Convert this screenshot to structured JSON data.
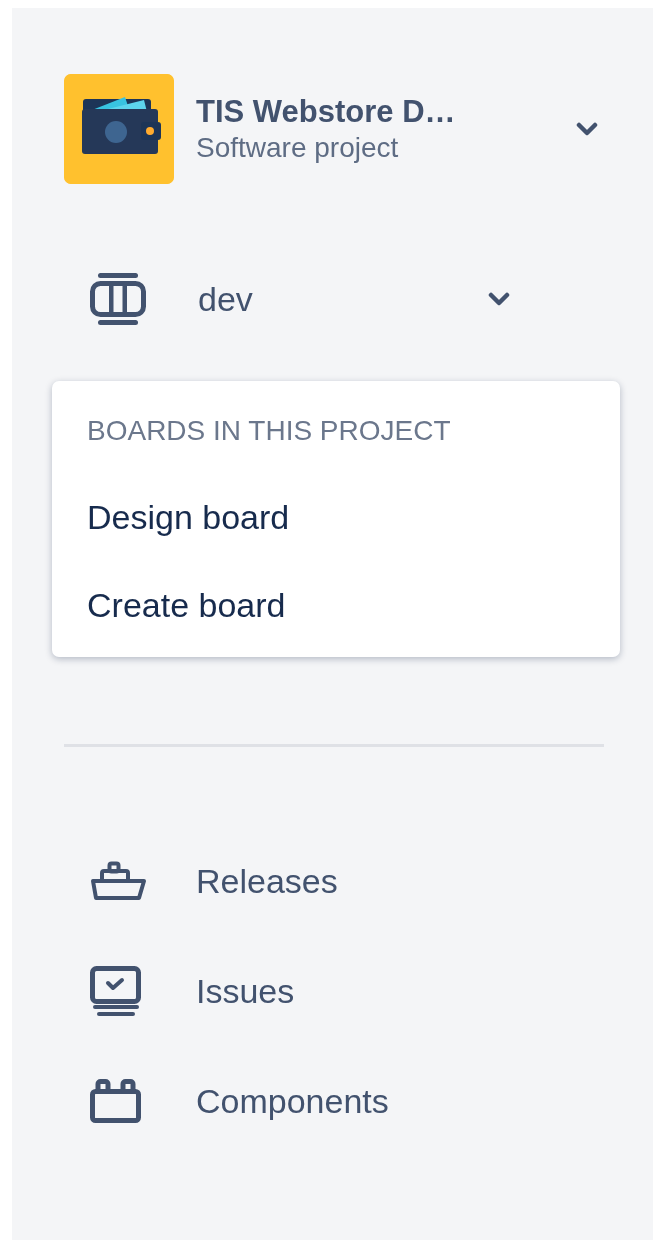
{
  "project": {
    "name": "TIS Webstore D…",
    "type": "Software project"
  },
  "board_selector": {
    "label": "dev",
    "expanded": true
  },
  "dropdown": {
    "heading": "BOARDS IN THIS PROJECT",
    "items": [
      {
        "label": "Design board"
      },
      {
        "label": "Create board"
      }
    ]
  },
  "nav_items": [
    {
      "kind": "releases",
      "label": "Releases"
    },
    {
      "kind": "issues",
      "label": "Issues"
    },
    {
      "kind": "components",
      "label": "Components"
    }
  ]
}
